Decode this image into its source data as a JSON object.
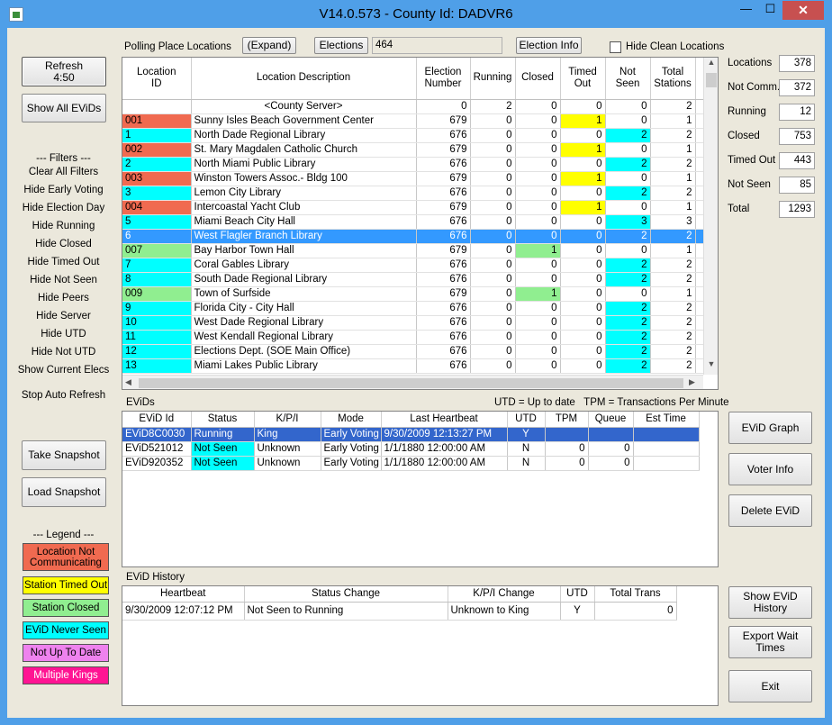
{
  "window": {
    "title": "V14.0.573 - County Id: DADVR6",
    "minimize": "—",
    "maximize": "☐",
    "close": "✕"
  },
  "left": {
    "refresh": "Refresh\n4:50",
    "show_all": "Show All EViDs",
    "filters_title": "--- Filters ---",
    "filters": [
      "Clear All Filters",
      "Hide Early Voting",
      "Hide Election Day",
      "Hide Running",
      "Hide Closed",
      "Hide Timed Out",
      "Hide Not Seen",
      "Hide Peers",
      "Hide Server",
      "Hide UTD",
      "Hide Not UTD",
      "Show Current Elecs"
    ],
    "stop_refresh": "Stop Auto Refresh",
    "take_snapshot": "Take Snapshot",
    "load_snapshot": "Load Snapshot",
    "legend_title": "--- Legend ---",
    "legend": [
      {
        "label": "Location Not Communicating",
        "color": "#f06a50"
      },
      {
        "label": "Station Timed Out",
        "color": "#ffff00"
      },
      {
        "label": "Station Closed",
        "color": "#90ee90"
      },
      {
        "label": "EViD Never Seen",
        "color": "#00ffff"
      },
      {
        "label": "Not Up To Date",
        "color": "#ee82ee"
      },
      {
        "label": "Multiple Kings",
        "color": "#ff1493"
      }
    ]
  },
  "top": {
    "polling_label": "Polling Place Locations",
    "expand": "(Expand)",
    "elections": "Elections",
    "election_value": "464",
    "election_info": "Election Info",
    "hide_clean": "Hide Clean Locations"
  },
  "stats": [
    {
      "label": "Locations",
      "value": "378"
    },
    {
      "label": "Not Comm.",
      "value": "372"
    },
    {
      "label": "Running",
      "value": "12"
    },
    {
      "label": "Closed",
      "value": "753"
    },
    {
      "label": "Timed Out",
      "value": "443"
    },
    {
      "label": "Not Seen",
      "value": "85"
    },
    {
      "label": "Total",
      "value": "1293"
    }
  ],
  "locations": {
    "headers": [
      "Location\nID",
      "Location Description",
      "Election\nNumber",
      "Running",
      "Closed",
      "Timed\nOut",
      "Not\nSeen",
      "Total\nStations"
    ],
    "rows": [
      {
        "id": "",
        "desc": "<County Server>",
        "elec": "0",
        "run": "2",
        "closed": "0",
        "to": "0",
        "ns": "0",
        "tot": "2",
        "idc": "",
        "cc": "",
        "toc": "",
        "nsc": ""
      },
      {
        "id": "001",
        "desc": "Sunny Isles Beach Government Center",
        "elec": "679",
        "run": "0",
        "closed": "0",
        "to": "1",
        "ns": "0",
        "tot": "1",
        "idc": "c-red",
        "cc": "",
        "toc": "c-yellow",
        "nsc": ""
      },
      {
        "id": "1",
        "desc": "North Dade Regional Library",
        "elec": "676",
        "run": "0",
        "closed": "0",
        "to": "0",
        "ns": "2",
        "tot": "2",
        "idc": "c-cyan",
        "cc": "",
        "toc": "",
        "nsc": "c-cyan"
      },
      {
        "id": "002",
        "desc": "St. Mary Magdalen Catholic Church",
        "elec": "679",
        "run": "0",
        "closed": "0",
        "to": "1",
        "ns": "0",
        "tot": "1",
        "idc": "c-red",
        "cc": "",
        "toc": "c-yellow",
        "nsc": ""
      },
      {
        "id": "2",
        "desc": "North Miami Public Library",
        "elec": "676",
        "run": "0",
        "closed": "0",
        "to": "0",
        "ns": "2",
        "tot": "2",
        "idc": "c-cyan",
        "cc": "",
        "toc": "",
        "nsc": "c-cyan"
      },
      {
        "id": "003",
        "desc": "Winston Towers Assoc.- Bldg 100",
        "elec": "679",
        "run": "0",
        "closed": "0",
        "to": "1",
        "ns": "0",
        "tot": "1",
        "idc": "c-red",
        "cc": "",
        "toc": "c-yellow",
        "nsc": ""
      },
      {
        "id": "3",
        "desc": "Lemon City Library",
        "elec": "676",
        "run": "0",
        "closed": "0",
        "to": "0",
        "ns": "2",
        "tot": "2",
        "idc": "c-cyan",
        "cc": "",
        "toc": "",
        "nsc": "c-cyan"
      },
      {
        "id": "004",
        "desc": "Intercoastal Yacht Club",
        "elec": "679",
        "run": "0",
        "closed": "0",
        "to": "1",
        "ns": "0",
        "tot": "1",
        "idc": "c-red",
        "cc": "",
        "toc": "c-yellow",
        "nsc": ""
      },
      {
        "id": "5",
        "desc": "Miami Beach City Hall",
        "elec": "676",
        "run": "0",
        "closed": "0",
        "to": "0",
        "ns": "3",
        "tot": "3",
        "idc": "c-cyan",
        "cc": "",
        "toc": "",
        "nsc": "c-cyan"
      },
      {
        "id": "6",
        "desc": "West Flagler Branch Library",
        "elec": "676",
        "run": "0",
        "closed": "0",
        "to": "0",
        "ns": "2",
        "tot": "2",
        "idc": "",
        "cc": "",
        "toc": "",
        "nsc": "",
        "sel": true
      },
      {
        "id": "007",
        "desc": "Bay Harbor Town Hall",
        "elec": "679",
        "run": "0",
        "closed": "1",
        "to": "0",
        "ns": "0",
        "tot": "1",
        "idc": "c-green",
        "cc": "c-green",
        "toc": "",
        "nsc": ""
      },
      {
        "id": "7",
        "desc": "Coral Gables Library",
        "elec": "676",
        "run": "0",
        "closed": "0",
        "to": "0",
        "ns": "2",
        "tot": "2",
        "idc": "c-cyan",
        "cc": "",
        "toc": "",
        "nsc": "c-cyan"
      },
      {
        "id": "8",
        "desc": "South Dade Regional Library",
        "elec": "676",
        "run": "0",
        "closed": "0",
        "to": "0",
        "ns": "2",
        "tot": "2",
        "idc": "c-cyan",
        "cc": "",
        "toc": "",
        "nsc": "c-cyan"
      },
      {
        "id": "009",
        "desc": "Town of Surfside",
        "elec": "679",
        "run": "0",
        "closed": "1",
        "to": "0",
        "ns": "0",
        "tot": "1",
        "idc": "c-green",
        "cc": "c-green",
        "toc": "",
        "nsc": ""
      },
      {
        "id": "9",
        "desc": "Florida City - City Hall",
        "elec": "676",
        "run": "0",
        "closed": "0",
        "to": "0",
        "ns": "2",
        "tot": "2",
        "idc": "c-cyan",
        "cc": "",
        "toc": "",
        "nsc": "c-cyan"
      },
      {
        "id": "10",
        "desc": "West Dade Regional Library",
        "elec": "676",
        "run": "0",
        "closed": "0",
        "to": "0",
        "ns": "2",
        "tot": "2",
        "idc": "c-cyan",
        "cc": "",
        "toc": "",
        "nsc": "c-cyan"
      },
      {
        "id": "11",
        "desc": "West Kendall Regional Library",
        "elec": "676",
        "run": "0",
        "closed": "0",
        "to": "0",
        "ns": "2",
        "tot": "2",
        "idc": "c-cyan",
        "cc": "",
        "toc": "",
        "nsc": "c-cyan"
      },
      {
        "id": "12",
        "desc": "Elections Dept. (SOE Main Office)",
        "elec": "676",
        "run": "0",
        "closed": "0",
        "to": "0",
        "ns": "2",
        "tot": "2",
        "idc": "c-cyan",
        "cc": "",
        "toc": "",
        "nsc": "c-cyan"
      },
      {
        "id": "13",
        "desc": "Miami Lakes Public Library",
        "elec": "676",
        "run": "0",
        "closed": "0",
        "to": "0",
        "ns": "2",
        "tot": "2",
        "idc": "c-cyan",
        "cc": "",
        "toc": "",
        "nsc": "c-cyan"
      }
    ]
  },
  "evids": {
    "label": "EViDs",
    "legend_note": "UTD = Up to date   TPM = Transactions Per Minute",
    "headers": [
      "EViD Id",
      "Status",
      "K/P/I",
      "Mode",
      "Last Heartbeat",
      "UTD",
      "TPM",
      "Queue",
      "Est Time"
    ],
    "rows": [
      {
        "id": "EViD8C0030",
        "status": "Running",
        "kpi": "King",
        "mode": "Early Voting",
        "hb": "9/30/2009 12:13:27 PM",
        "utd": "Y",
        "tpm": "",
        "queue": "",
        "est": "",
        "sel": true
      },
      {
        "id": "EViD521012",
        "status": "Not Seen",
        "kpi": "Unknown",
        "mode": "Early Voting",
        "hb": "1/1/1880 12:00:00 AM",
        "utd": "N",
        "tpm": "0",
        "queue": "0",
        "est": ""
      },
      {
        "id": "EViD920352",
        "status": "Not Seen",
        "kpi": "Unknown",
        "mode": "Early Voting",
        "hb": "1/1/1880 12:00:00 AM",
        "utd": "N",
        "tpm": "0",
        "queue": "0",
        "est": ""
      }
    ]
  },
  "history": {
    "label": "EViD History",
    "headers": [
      "Heartbeat",
      "Status Change",
      "K/P/I Change",
      "UTD",
      "Total Trans"
    ],
    "rows": [
      {
        "hb": "9/30/2009 12:07:12 PM",
        "status": "Not Seen to Running",
        "kpi": "Unknown to King",
        "utd": "Y",
        "trans": "0"
      }
    ]
  },
  "right": {
    "evid_graph": "EViD Graph",
    "voter_info": "Voter Info",
    "delete_evid": "Delete EViD",
    "show_history": "Show EViD\nHistory",
    "export_wait": "Export Wait\nTimes",
    "exit": "Exit"
  }
}
